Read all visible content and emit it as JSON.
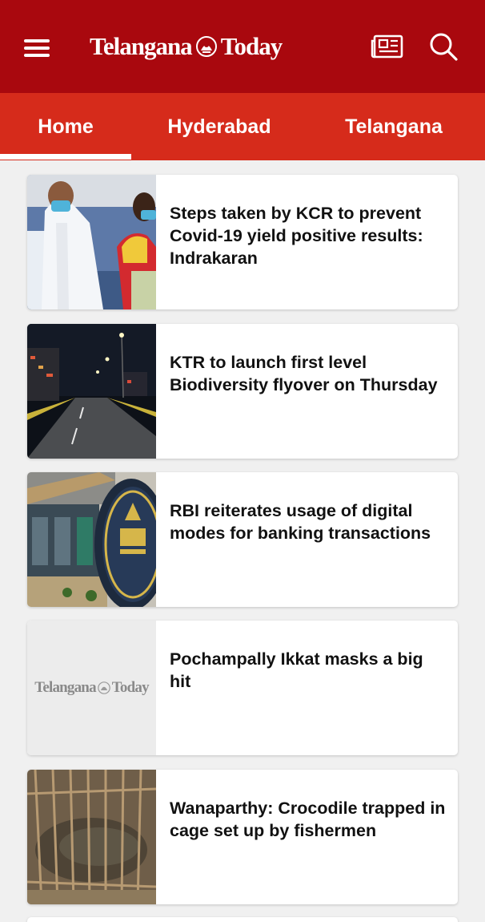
{
  "app": {
    "brand_part1": "Telangana",
    "brand_part2": "Today",
    "icons": {
      "menu": "hamburger-menu-icon",
      "epaper": "newspaper-icon",
      "search": "search-icon"
    },
    "colors": {
      "appbar": "#a9080e",
      "tabbar": "#d62b1b",
      "background": "#f0f0f0"
    }
  },
  "tabs": [
    {
      "label": "Home",
      "active": true
    },
    {
      "label": "Hyderabad",
      "active": false
    },
    {
      "label": "Telangana",
      "active": false
    }
  ],
  "articles": [
    {
      "headline": "Steps taken by KCR to prevent Covid-19 yield positive results: Indrakaran",
      "thumbnail": "photo"
    },
    {
      "headline": "KTR to launch first level Biodiversity flyover on Thursday",
      "thumbnail": "photo"
    },
    {
      "headline": "RBI reiterates usage of digital modes for banking transactions",
      "thumbnail": "photo"
    },
    {
      "headline": "Pochampally Ikkat masks a big hit",
      "thumbnail": "placeholder",
      "placeholder_part1": "Telangana",
      "placeholder_part2": "Today"
    },
    {
      "headline": "Wanaparthy: Crocodile trapped in cage set up by fishermen",
      "thumbnail": "photo"
    }
  ]
}
